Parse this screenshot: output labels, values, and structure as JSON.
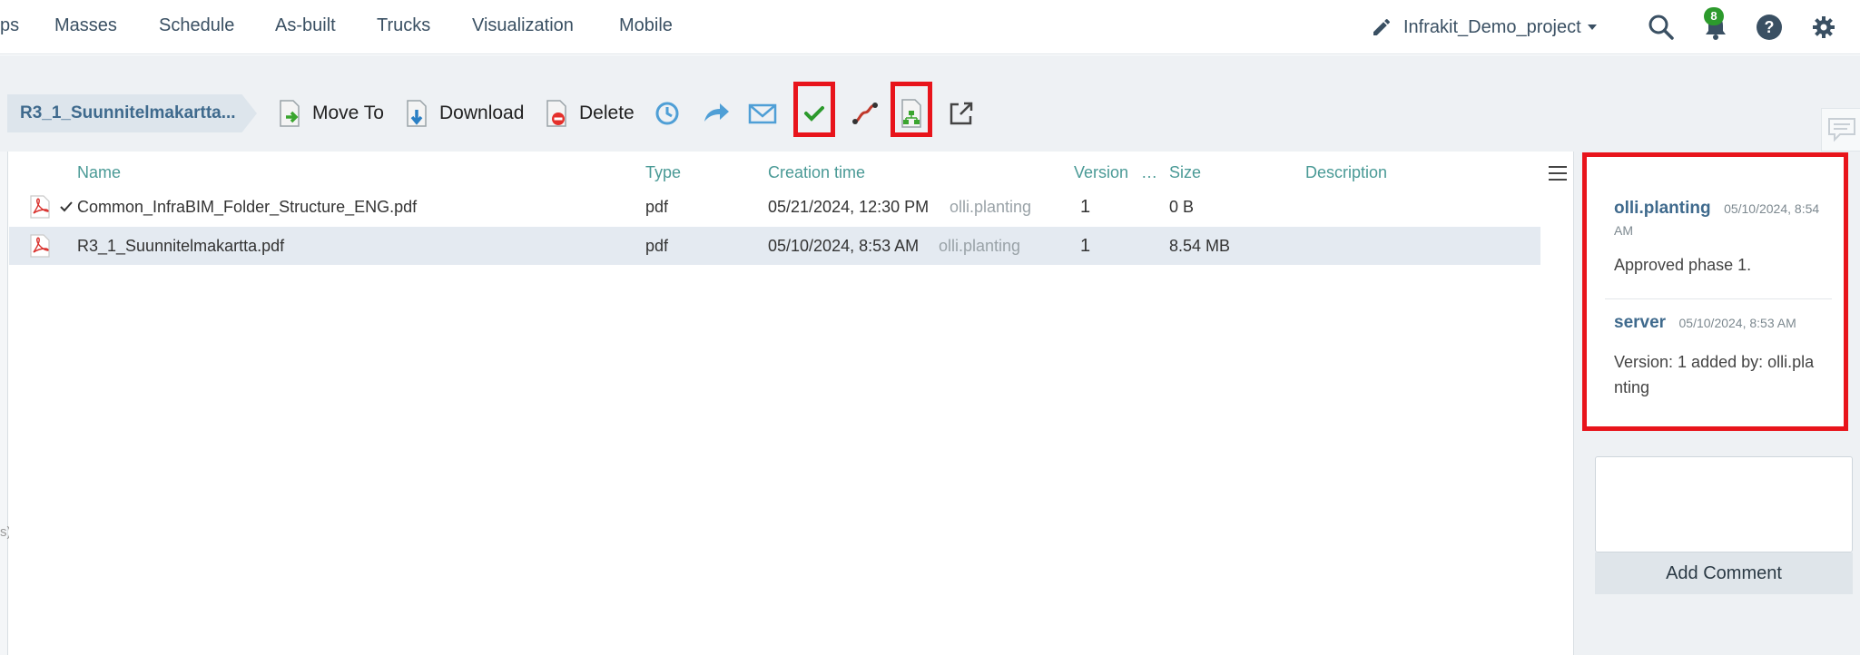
{
  "nav": {
    "items": [
      "ps",
      "Masses",
      "Schedule",
      "As-built",
      "Trucks",
      "Visualization",
      "Mobile"
    ],
    "project": "Infrakit_Demo_project",
    "notifications": "8"
  },
  "toolbar": {
    "breadcrumb": "R3_1_Suunnitelmakartta...",
    "move_to": "Move To",
    "download": "Download",
    "delete": "Delete"
  },
  "table": {
    "headers": {
      "name": "Name",
      "type": "Type",
      "creation": "Creation time",
      "version": "Version",
      "ellipsis": "…",
      "size": "Size",
      "description": "Description"
    },
    "rows": [
      {
        "name": "Common_InfraBIM_Folder_Structure_ENG.pdf",
        "checked": true,
        "type": "pdf",
        "created": "05/21/2024, 12:30 PM",
        "user": "olli.planting",
        "version": "1",
        "size": "0 B",
        "description": ""
      },
      {
        "name": "R3_1_Suunnitelmakartta.pdf",
        "checked": false,
        "type": "pdf",
        "created": "05/10/2024, 8:53 AM",
        "user": "olli.planting",
        "version": "1",
        "size": "8.54 MB",
        "description": ""
      }
    ]
  },
  "comments": [
    {
      "author": "olli.planting",
      "time_line1": "05/10/2024, 8:54",
      "time_line2": "AM",
      "text": "Approved phase 1."
    },
    {
      "author": "server",
      "time": "05/10/2024, 8:53 AM",
      "text_line1": "Version: 1 added by: olli.pla",
      "text_line2": "nting"
    }
  ],
  "add_comment": "Add Comment",
  "left_edge_text": "s)",
  "colors": {
    "accent": "#3f6a8d",
    "highlight": "#e8141b",
    "header": "#4a9a96",
    "badge": "#2c9a2c"
  }
}
